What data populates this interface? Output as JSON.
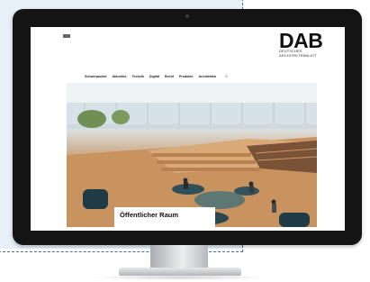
{
  "site": {
    "utility_lines": [
      "",
      "",
      ""
    ],
    "logo_main": "DAB",
    "logo_sub_1": "DEUTSCHES",
    "logo_sub_2": "ARCHITEKTENBLATT",
    "nav": [
      "Schwerpunkte",
      "Aktuelles",
      "Technik",
      "Digital",
      "Recht",
      "Produkte",
      "Architekten"
    ],
    "search_icon": "search-icon",
    "hero": {
      "caption_title": "Öffentlicher Raum",
      "caption_body": ""
    }
  },
  "colors": {
    "monitor_bezel": "#141414",
    "dash_border": "#3f6fa8",
    "panel": "#e7f0f7",
    "wood": "#c08d5e"
  }
}
